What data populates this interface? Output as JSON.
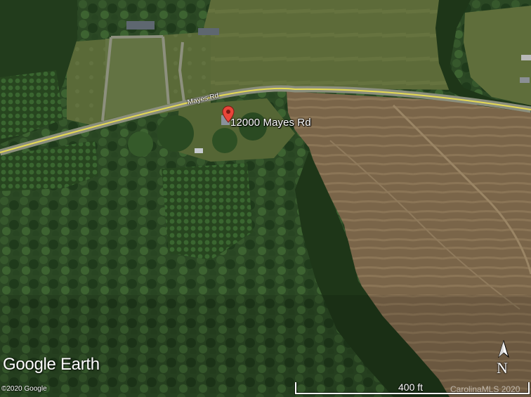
{
  "map": {
    "place_label": "12000 Mayes Rd",
    "road_label": "Mayes Rd",
    "brand": "Google Earth",
    "copyright": "©2020 Google",
    "scale_label": "400 ft",
    "watermark": "CarolinaMLS 2020",
    "north_label": "N",
    "pin_color": "#e8463a",
    "road_color": "#e6da54"
  },
  "icons": {
    "location_pin": "map-pin-icon",
    "compass": "north-arrow-icon"
  }
}
